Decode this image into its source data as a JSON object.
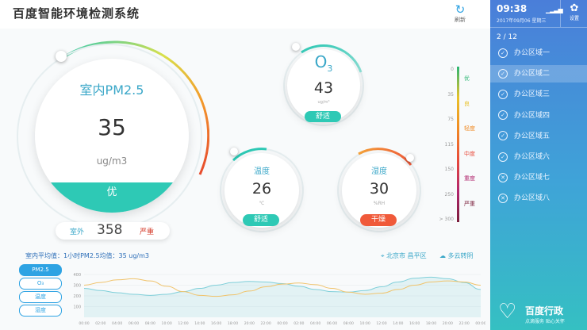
{
  "header": {
    "title": "百度智能环境检测系统",
    "refresh_label": "刷新"
  },
  "pm25": {
    "label": "室内PM2.5",
    "value": "35",
    "unit": "ug/m3",
    "level": "优"
  },
  "outdoor": {
    "label": "室外",
    "value": "358",
    "level": "严重"
  },
  "o3": {
    "label": "O",
    "sub": "3",
    "value": "43",
    "unit": "ug/m³",
    "level": "舒适"
  },
  "temperature": {
    "label": "温度",
    "value": "26",
    "unit": "℃",
    "level": "舒适"
  },
  "humidity": {
    "label": "湿度",
    "value": "30",
    "unit": "%RH",
    "level": "干燥"
  },
  "scale": {
    "numbers": [
      "0",
      "35",
      "75",
      "115",
      "150",
      "250",
      "> 300"
    ],
    "levels": [
      "优",
      "良",
      "轻度",
      "中度",
      "重度",
      "严重"
    ],
    "level_colors": [
      "#2bb673",
      "#e9c12a",
      "#f08a24",
      "#e84a3a",
      "#b1266e",
      "#7a1d3a"
    ]
  },
  "summary": {
    "text": "室内平均值：1小时PM2.5均值：35 ug/m3",
    "location": "北京市 昌平区",
    "weather": "多云转阴"
  },
  "chart": {
    "tabs": [
      "PM2.5",
      "O₃",
      "温度",
      "湿度"
    ],
    "y_ticks": [
      "400",
      "300",
      "200",
      "100"
    ],
    "x_ticks": [
      "00:00",
      "02:00",
      "04:00",
      "06:00",
      "08:00",
      "10:00",
      "12:00",
      "14:00",
      "16:00",
      "18:00",
      "20:00",
      "22:00",
      "00:00",
      "02:00",
      "04:00",
      "06:00",
      "08:00",
      "10:00",
      "12:00",
      "14:00",
      "16:00",
      "18:00",
      "20:00",
      "22:00",
      "00:00"
    ]
  },
  "chart_data": {
    "type": "area",
    "y_range": [
      0,
      400
    ],
    "x": [
      "00:00",
      "02:00",
      "04:00",
      "06:00",
      "08:00",
      "10:00",
      "12:00",
      "14:00",
      "16:00",
      "18:00",
      "20:00",
      "22:00",
      "00:00",
      "02:00",
      "04:00",
      "06:00",
      "08:00",
      "10:00",
      "12:00",
      "14:00",
      "16:00",
      "18:00",
      "20:00",
      "22:00",
      "00:00"
    ],
    "series": [
      {
        "values": [
          270,
          250,
          230,
          215,
          205,
          215,
          240,
          270,
          300,
          325,
          335,
          330,
          315,
          290,
          260,
          240,
          235,
          250,
          285,
          330,
          365,
          375,
          360,
          325,
          260
        ]
      },
      {
        "values": [
          300,
          325,
          350,
          360,
          340,
          290,
          240,
          205,
          195,
          210,
          245,
          285,
          310,
          320,
          305,
          270,
          235,
          215,
          225,
          260,
          300,
          330,
          340,
          330,
          300
        ]
      }
    ],
    "colors": [
      "#7fcfd9",
      "#f0c36b"
    ]
  },
  "sidebar": {
    "time": "09:38",
    "date": "2017年09月06 星期三",
    "settings_label": "设置",
    "page": "2 / 12",
    "items": [
      {
        "label": "办公区域一",
        "icon": "check-circle-icon"
      },
      {
        "label": "办公区域二",
        "icon": "check-circle-icon"
      },
      {
        "label": "办公区域三",
        "icon": "check-circle-icon"
      },
      {
        "label": "办公区域四",
        "icon": "check-circle-icon"
      },
      {
        "label": "办公区域五",
        "icon": "check-circle-icon"
      },
      {
        "label": "办公区域六",
        "icon": "check-circle-icon"
      },
      {
        "label": "办公区域七",
        "icon": "x-circle-icon"
      },
      {
        "label": "办公区域八",
        "icon": "x-circle-icon"
      }
    ],
    "brand": "百度行政",
    "slogan": "点滴服务 贴心关怀"
  },
  "colors": {
    "teal": "#2ec9b5",
    "blue": "#2ea3e3",
    "red": "#f05a3a",
    "dark_red": "#d43b2a"
  }
}
